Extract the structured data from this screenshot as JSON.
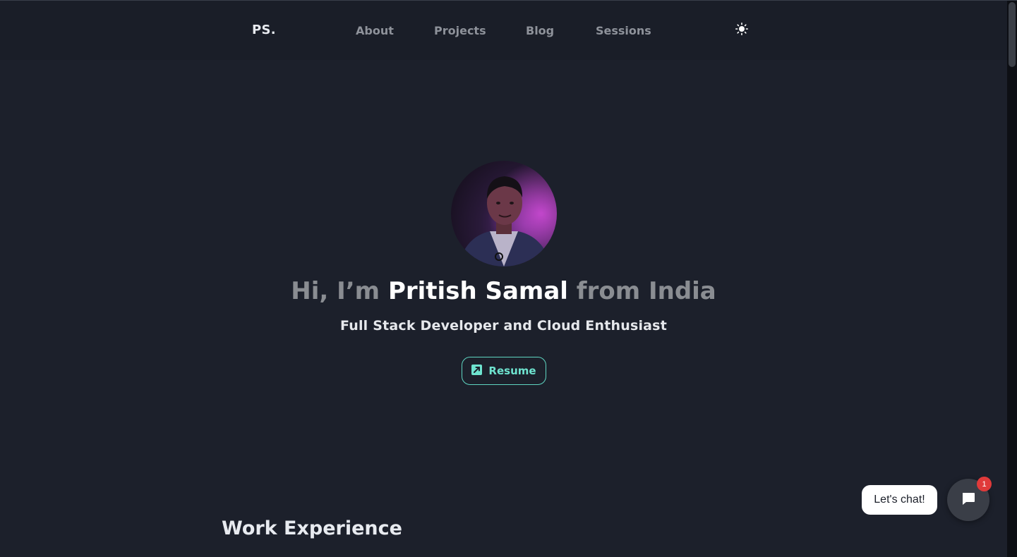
{
  "header": {
    "logo": "PS.",
    "nav": [
      {
        "label": "About"
      },
      {
        "label": "Projects"
      },
      {
        "label": "Blog"
      },
      {
        "label": "Sessions"
      }
    ],
    "theme_icon": "sun-icon"
  },
  "hero": {
    "greeting": "Hi, I’m ",
    "name": "Pritish Samal",
    "location": " from India",
    "subtitle": "Full Stack Developer and Cloud Enthusiast",
    "resume_label": "Resume",
    "resume_icon": "external-link-icon",
    "accent_color": "#6ee3cf"
  },
  "sections": {
    "work_title": "Work Experience"
  },
  "chat": {
    "bubble_label": "Let's chat!",
    "badge_count": "1",
    "icon": "chat-icon"
  }
}
